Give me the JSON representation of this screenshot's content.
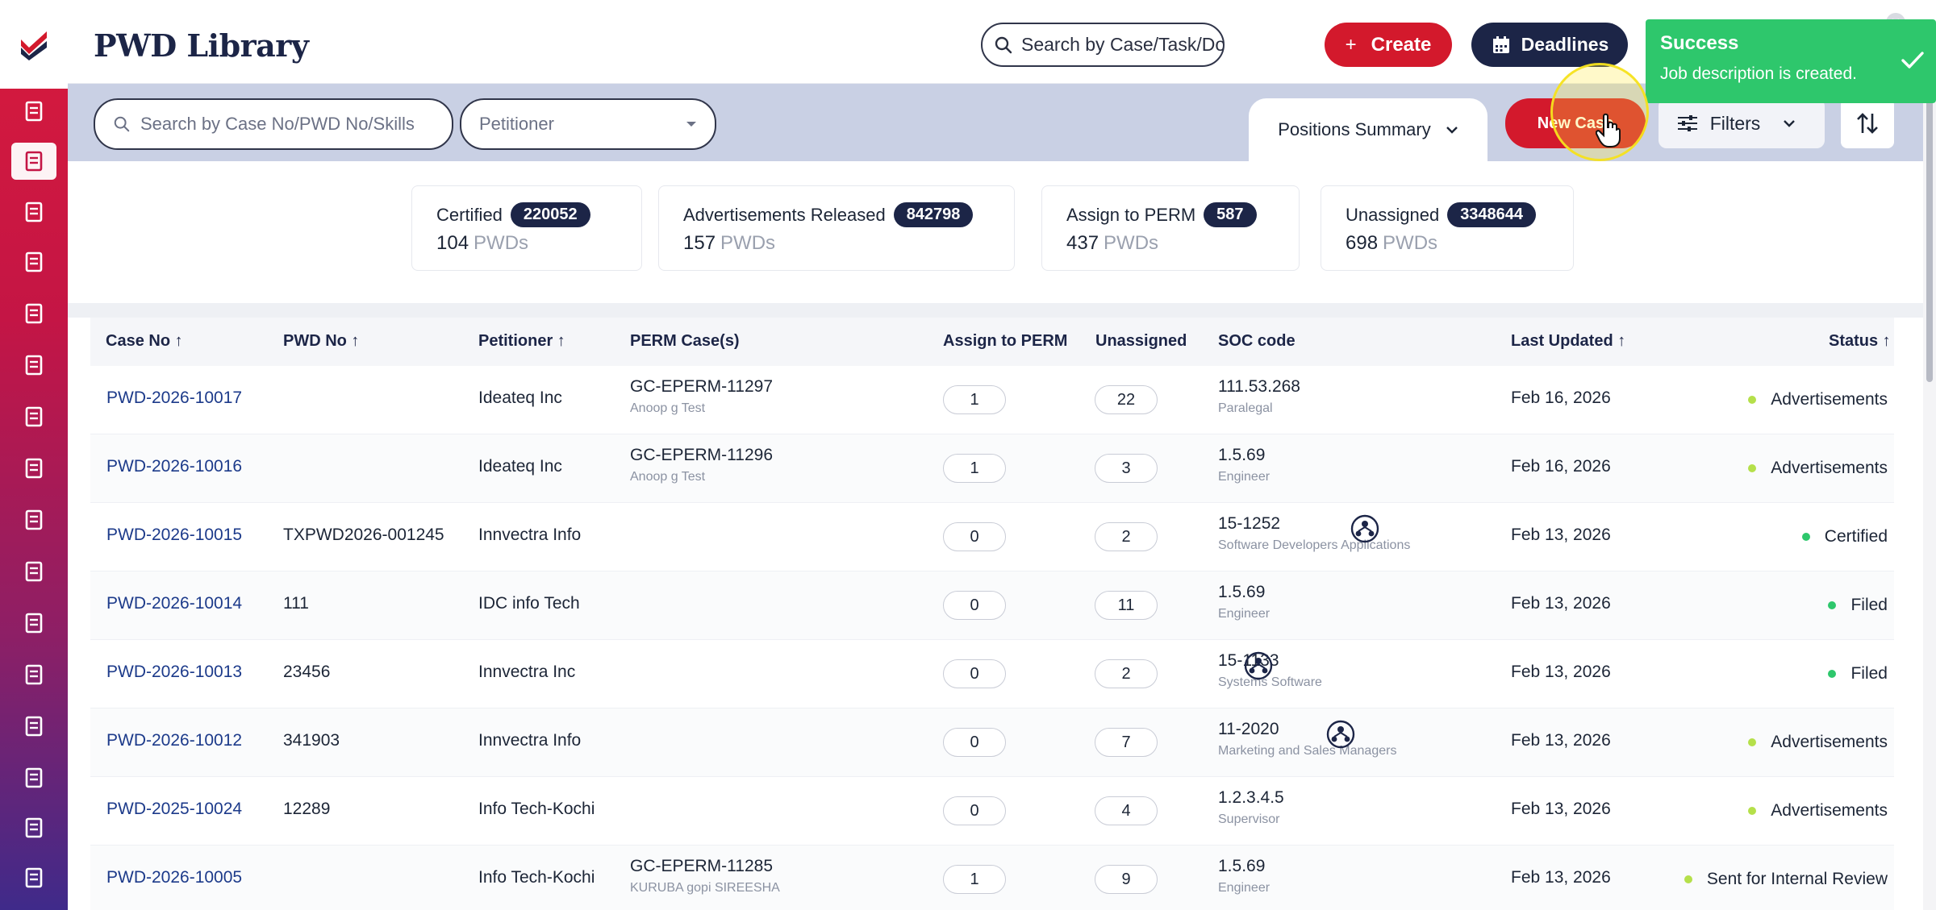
{
  "app": {
    "title": "PWD Library"
  },
  "topbar": {
    "search_placeholder": "Search by Case/Task/Docu",
    "create_label": "Create",
    "create_plus": "+",
    "deadlines_label": "Deadlines"
  },
  "toast": {
    "title": "Success",
    "message": "Job description is created."
  },
  "filterbar": {
    "case_search_placeholder": "Search by Case No/PWD No/Skills",
    "petitioner_placeholder": "Petitioner",
    "positions_summary_label": "Positions Summary",
    "new_case_label": "New Case",
    "filters_label": "Filters"
  },
  "summary": [
    {
      "label": "Certified",
      "badge": "220052",
      "count": "104",
      "unit": "PWDs"
    },
    {
      "label": "Advertisements Released",
      "badge": "842798",
      "count": "157",
      "unit": "PWDs"
    },
    {
      "label": "Assign to PERM",
      "badge": "587",
      "count": "437",
      "unit": "PWDs"
    },
    {
      "label": "Unassigned",
      "badge": "3348644",
      "count": "698",
      "unit": "PWDs"
    }
  ],
  "table": {
    "headers": {
      "case_no": "Case No ↑",
      "pwd_no": "PWD No ↑",
      "petitioner": "Petitioner ↑",
      "perm_cases": "PERM Case(s)",
      "assign_to_perm": "Assign to PERM",
      "unassigned": "Unassigned",
      "soc_code": "SOC code",
      "last_updated": "Last Updated ↑",
      "status": "Status ↑"
    },
    "rows": [
      {
        "case_no": "PWD-2026-10017",
        "pwd_no": "",
        "petitioner": "Ideateq Inc",
        "perm_case": "GC-EPERM-11297",
        "perm_sub": "Anoop g Test",
        "assign": "1",
        "unassigned": "22",
        "soc": "111.53.268",
        "soc_sub": "Paralegal",
        "soc_icon": false,
        "updated": "Feb 16, 2026",
        "status": "Advertisements",
        "status_color": "#b5e04a"
      },
      {
        "case_no": "PWD-2026-10016",
        "pwd_no": "",
        "petitioner": "Ideateq Inc",
        "perm_case": "GC-EPERM-11296",
        "perm_sub": "Anoop g Test",
        "assign": "1",
        "unassigned": "3",
        "soc": "1.5.69",
        "soc_sub": "Engineer",
        "soc_icon": false,
        "updated": "Feb 16, 2026",
        "status": "Advertisements",
        "status_color": "#b5e04a"
      },
      {
        "case_no": "PWD-2026-10015",
        "pwd_no": "TXPWD2026-001245",
        "petitioner": "Innvectra Info",
        "perm_case": "",
        "perm_sub": "",
        "assign": "0",
        "unassigned": "2",
        "soc": "15-1252",
        "soc_sub": "Software Developers Applications",
        "soc_icon": true,
        "updated": "Feb 13, 2026",
        "status": "Certified",
        "status_color": "#2ec76c"
      },
      {
        "case_no": "PWD-2026-10014",
        "pwd_no": "111",
        "petitioner": "IDC info Tech",
        "perm_case": "",
        "perm_sub": "",
        "assign": "0",
        "unassigned": "11",
        "soc": "1.5.69",
        "soc_sub": "Engineer",
        "soc_icon": false,
        "updated": "Feb 13, 2026",
        "status": "Filed",
        "status_color": "#2ec76c"
      },
      {
        "case_no": "PWD-2026-10013",
        "pwd_no": "23456",
        "petitioner": "Innvectra Inc",
        "perm_case": "",
        "perm_sub": "",
        "assign": "0",
        "unassigned": "2",
        "soc": "15-1133",
        "soc_sub": "Systems Software",
        "soc_icon": true,
        "updated": "Feb 13, 2026",
        "status": "Filed",
        "status_color": "#2ec76c"
      },
      {
        "case_no": "PWD-2026-10012",
        "pwd_no": "341903",
        "petitioner": "Innvectra Info",
        "perm_case": "",
        "perm_sub": "",
        "assign": "0",
        "unassigned": "7",
        "soc": "11-2020",
        "soc_sub": "Marketing and Sales Managers",
        "soc_icon": true,
        "updated": "Feb 13, 2026",
        "status": "Advertisements",
        "status_color": "#b5e04a"
      },
      {
        "case_no": "PWD-2025-10024",
        "pwd_no": "12289",
        "petitioner": "Info Tech-Kochi",
        "perm_case": "",
        "perm_sub": "",
        "assign": "0",
        "unassigned": "4",
        "soc": "1.2.3.4.5",
        "soc_sub": "Supervisor",
        "soc_icon": false,
        "updated": "Feb 13, 2026",
        "status": "Advertisements",
        "status_color": "#b5e04a"
      },
      {
        "case_no": "PWD-2026-10005",
        "pwd_no": "",
        "petitioner": "Info Tech-Kochi",
        "perm_case": "GC-EPERM-11285",
        "perm_sub": "KURUBA gopi SIREESHA",
        "assign": "1",
        "unassigned": "9",
        "soc": "1.5.69",
        "soc_sub": "Engineer",
        "soc_icon": false,
        "updated": "Feb 13, 2026",
        "status": "Sent for Internal Review",
        "status_color": "#b5e04a"
      }
    ]
  },
  "sidebar": {
    "icons": [
      "dashboard-icon",
      "cases-icon",
      "documents-icon",
      "tasks-icon",
      "forms-icon",
      "messages-icon",
      "reports-icon",
      "edit-icon",
      "library-icon",
      "clipboard-icon",
      "user-icon",
      "users-icon",
      "folder-icon",
      "notes-icon",
      "profile-icon",
      "book-icon"
    ]
  },
  "colors": {
    "brand_red": "#d3192c",
    "navy": "#1c2547",
    "success": "#2ec76c"
  }
}
